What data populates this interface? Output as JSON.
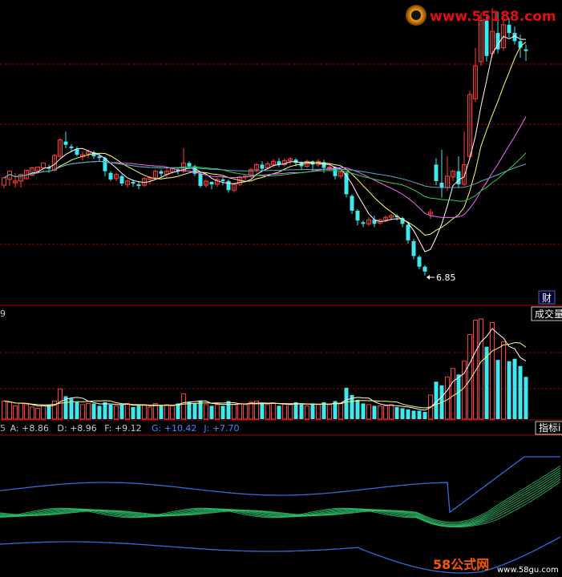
{
  "watermarks": {
    "site_url": "www.55188.com",
    "bottom_brand": "58公式网",
    "bottom_url": "www.58gu.com"
  },
  "price_panel": {
    "low_marker_label": "6.85",
    "tab_label": "财"
  },
  "volume_panel": {
    "left_label": "9",
    "button_label": "成交量"
  },
  "indicator_panel": {
    "readout_parts": [
      {
        "text": "5",
        "color": "#b0b0b0"
      },
      {
        "text": "A: +8.86",
        "color": "#c8c8c8"
      },
      {
        "text": "D: +8.96",
        "color": "#c8c8c8"
      },
      {
        "text": "F: +9.12",
        "color": "#c8c8c8"
      },
      {
        "text": "G: +10.42",
        "color": "#3f8cff"
      },
      {
        "text": "J: +7.70",
        "color": "#3f8cff"
      }
    ],
    "button_label": "指标i"
  },
  "colors": {
    "up": "#ff3b3b",
    "down": "#3fe8ee",
    "ma5": "#ffffff",
    "ma10": "#ffff66",
    "ma20": "#ff66ff",
    "ma30": "#33cc55",
    "ma60": "#55aacc",
    "grid": "#8b0000",
    "indicator_blue": "#2d6de0",
    "indicator_green": "#2ebf6a"
  },
  "chart_data": [
    {
      "type": "candlestick",
      "title": "",
      "annotations": [
        "6.85"
      ],
      "ohlc": [
        [
          7.95,
          8.04,
          7.94,
          7.91
        ],
        [
          8.02,
          8.12,
          7.94,
          8.05
        ],
        [
          7.98,
          8.0,
          7.92,
          8.1
        ],
        [
          8.0,
          8.08,
          7.92,
          8.09
        ],
        [
          8.03,
          8.13,
          8.02,
          8.14
        ],
        [
          8.07,
          8.16,
          8.06,
          8.18
        ],
        [
          8.12,
          8.17,
          8.1,
          8.15
        ],
        [
          8.16,
          8.22,
          8.12,
          8.14
        ],
        [
          8.17,
          8.15,
          8.1,
          8.2
        ],
        [
          8.13,
          8.31,
          8.12,
          8.33
        ],
        [
          8.3,
          8.5,
          8.28,
          8.52
        ],
        [
          8.48,
          8.44,
          8.4,
          8.6
        ],
        [
          8.42,
          8.4,
          8.36,
          8.45
        ],
        [
          8.39,
          8.32,
          8.3,
          8.42
        ],
        [
          8.3,
          8.32,
          8.25,
          8.36
        ],
        [
          8.33,
          8.36,
          8.28,
          8.38
        ],
        [
          8.35,
          8.3,
          8.27,
          8.37
        ],
        [
          8.3,
          8.28,
          8.24,
          8.33
        ],
        [
          8.28,
          8.12,
          8.06,
          8.3
        ],
        [
          8.1,
          8.02,
          8.0,
          8.12
        ],
        [
          8.03,
          8.08,
          8.0,
          8.1
        ],
        [
          8.06,
          7.97,
          7.94,
          8.08
        ],
        [
          7.96,
          8.0,
          7.92,
          8.02
        ],
        [
          7.99,
          7.97,
          7.93,
          8.02
        ],
        [
          7.96,
          7.94,
          7.9,
          8.0
        ],
        [
          7.95,
          8.03,
          7.93,
          8.05
        ],
        [
          8.02,
          8.04,
          7.96,
          8.06
        ],
        [
          8.04,
          8.12,
          8.02,
          8.14
        ],
        [
          8.12,
          8.09,
          8.05,
          8.14
        ],
        [
          8.08,
          8.12,
          8.04,
          8.16
        ],
        [
          8.11,
          8.15,
          8.09,
          8.17
        ],
        [
          8.14,
          8.12,
          8.08,
          8.16
        ],
        [
          8.12,
          8.22,
          8.1,
          8.4
        ],
        [
          8.22,
          8.18,
          8.14,
          8.24
        ],
        [
          8.18,
          8.09,
          8.06,
          8.2
        ],
        [
          8.09,
          7.94,
          7.92,
          8.1
        ],
        [
          7.95,
          8.0,
          7.92,
          8.02
        ],
        [
          7.99,
          7.96,
          7.9,
          8.0
        ],
        [
          7.96,
          8.02,
          7.93,
          8.04
        ],
        [
          8.02,
          8.0,
          7.95,
          8.05
        ],
        [
          8.0,
          7.89,
          7.86,
          8.02
        ],
        [
          7.89,
          7.96,
          7.86,
          7.98
        ],
        [
          7.96,
          8.05,
          7.94,
          8.07
        ],
        [
          8.05,
          8.06,
          8.01,
          8.08
        ],
        [
          8.06,
          8.14,
          8.04,
          8.16
        ],
        [
          8.14,
          8.2,
          8.1,
          8.22
        ],
        [
          8.2,
          8.15,
          8.12,
          8.24
        ],
        [
          8.16,
          8.21,
          8.14,
          8.24
        ],
        [
          8.2,
          8.24,
          8.16,
          8.27
        ],
        [
          8.24,
          8.2,
          8.17,
          8.28
        ],
        [
          8.2,
          8.25,
          8.18,
          8.28
        ],
        [
          8.25,
          8.27,
          8.2,
          8.29
        ],
        [
          8.26,
          8.22,
          8.18,
          8.28
        ],
        [
          8.22,
          8.18,
          8.14,
          8.24
        ],
        [
          8.18,
          8.24,
          8.16,
          8.26
        ],
        [
          8.24,
          8.2,
          8.12,
          8.25
        ],
        [
          8.2,
          8.24,
          8.17,
          8.27
        ],
        [
          8.23,
          8.16,
          8.1,
          8.26
        ],
        [
          8.16,
          8.17,
          8.12,
          8.2
        ],
        [
          8.17,
          8.06,
          8.02,
          8.18
        ],
        [
          8.06,
          8.11,
          8.03,
          8.13
        ],
        [
          8.1,
          7.84,
          7.8,
          8.12
        ],
        [
          7.82,
          7.64,
          7.6,
          7.84
        ],
        [
          7.64,
          7.52,
          7.46,
          7.66
        ],
        [
          7.5,
          7.48,
          7.44,
          7.52
        ],
        [
          7.48,
          7.53,
          7.45,
          7.56
        ],
        [
          7.53,
          7.48,
          7.44,
          7.58
        ],
        [
          7.49,
          7.53,
          7.47,
          7.54
        ],
        [
          7.53,
          7.56,
          7.5,
          7.58
        ],
        [
          7.56,
          7.58,
          7.52,
          7.6
        ],
        [
          7.58,
          7.56,
          7.52,
          7.6
        ],
        [
          7.55,
          7.48,
          7.44,
          7.57
        ],
        [
          7.47,
          7.28,
          7.24,
          7.49
        ],
        [
          7.27,
          7.09,
          7.05,
          7.3
        ],
        [
          7.08,
          6.96,
          6.93,
          7.1
        ],
        [
          6.96,
          6.9,
          6.85,
          6.98
        ],
        [
          7.6,
          7.62,
          7.54,
          7.66
        ],
        [
          8.2,
          8.0,
          7.95,
          8.28
        ],
        [
          7.98,
          7.92,
          7.8,
          8.38
        ],
        [
          7.92,
          8.06,
          7.88,
          8.3
        ],
        [
          8.05,
          8.12,
          8.0,
          8.14
        ],
        [
          8.12,
          7.96,
          7.92,
          8.3
        ],
        [
          7.96,
          8.2,
          7.94,
          8.6
        ],
        [
          8.3,
          9.05,
          8.26,
          9.1
        ],
        [
          9.0,
          9.4,
          8.96,
          9.62
        ],
        [
          9.45,
          9.95,
          9.4,
          10.05
        ],
        [
          9.95,
          9.52,
          9.45,
          10.0
        ],
        [
          9.55,
          9.82,
          9.5,
          10.1
        ],
        [
          9.8,
          9.6,
          9.55,
          10.06
        ],
        [
          9.62,
          9.9,
          9.58,
          10.02
        ],
        [
          9.9,
          9.8,
          9.74,
          9.98
        ],
        [
          9.8,
          9.7,
          9.66,
          9.88
        ],
        [
          9.7,
          9.62,
          9.5,
          9.78
        ],
        [
          9.6,
          9.58,
          9.46,
          9.66
        ]
      ],
      "moving_average_periods": [
        5,
        10,
        20,
        30,
        60
      ]
    },
    {
      "type": "bar",
      "title": "",
      "volume": [
        30,
        28,
        22,
        26,
        24,
        20,
        18,
        22,
        24,
        30,
        50,
        38,
        34,
        28,
        24,
        26,
        26,
        22,
        28,
        24,
        22,
        24,
        26,
        20,
        22,
        24,
        20,
        26,
        22,
        24,
        22,
        26,
        42,
        28,
        26,
        30,
        24,
        22,
        24,
        22,
        30,
        24,
        26,
        24,
        28,
        30,
        26,
        24,
        26,
        22,
        26,
        24,
        28,
        24,
        22,
        26,
        24,
        28,
        24,
        30,
        26,
        52,
        40,
        32,
        26,
        24,
        22,
        22,
        22,
        24,
        20,
        18,
        16,
        14,
        14,
        12,
        40,
        62,
        56,
        70,
        84,
        74,
        96,
        140,
        164,
        166,
        120,
        160,
        98,
        128,
        96,
        100,
        88,
        70
      ]
    },
    {
      "type": "line",
      "title": "",
      "legend": [
        "A",
        "D",
        "F",
        "G",
        "J"
      ],
      "last_values": {
        "A": 8.86,
        "D": 8.96,
        "F": 9.12,
        "G": 10.42,
        "J": 7.7
      }
    }
  ]
}
